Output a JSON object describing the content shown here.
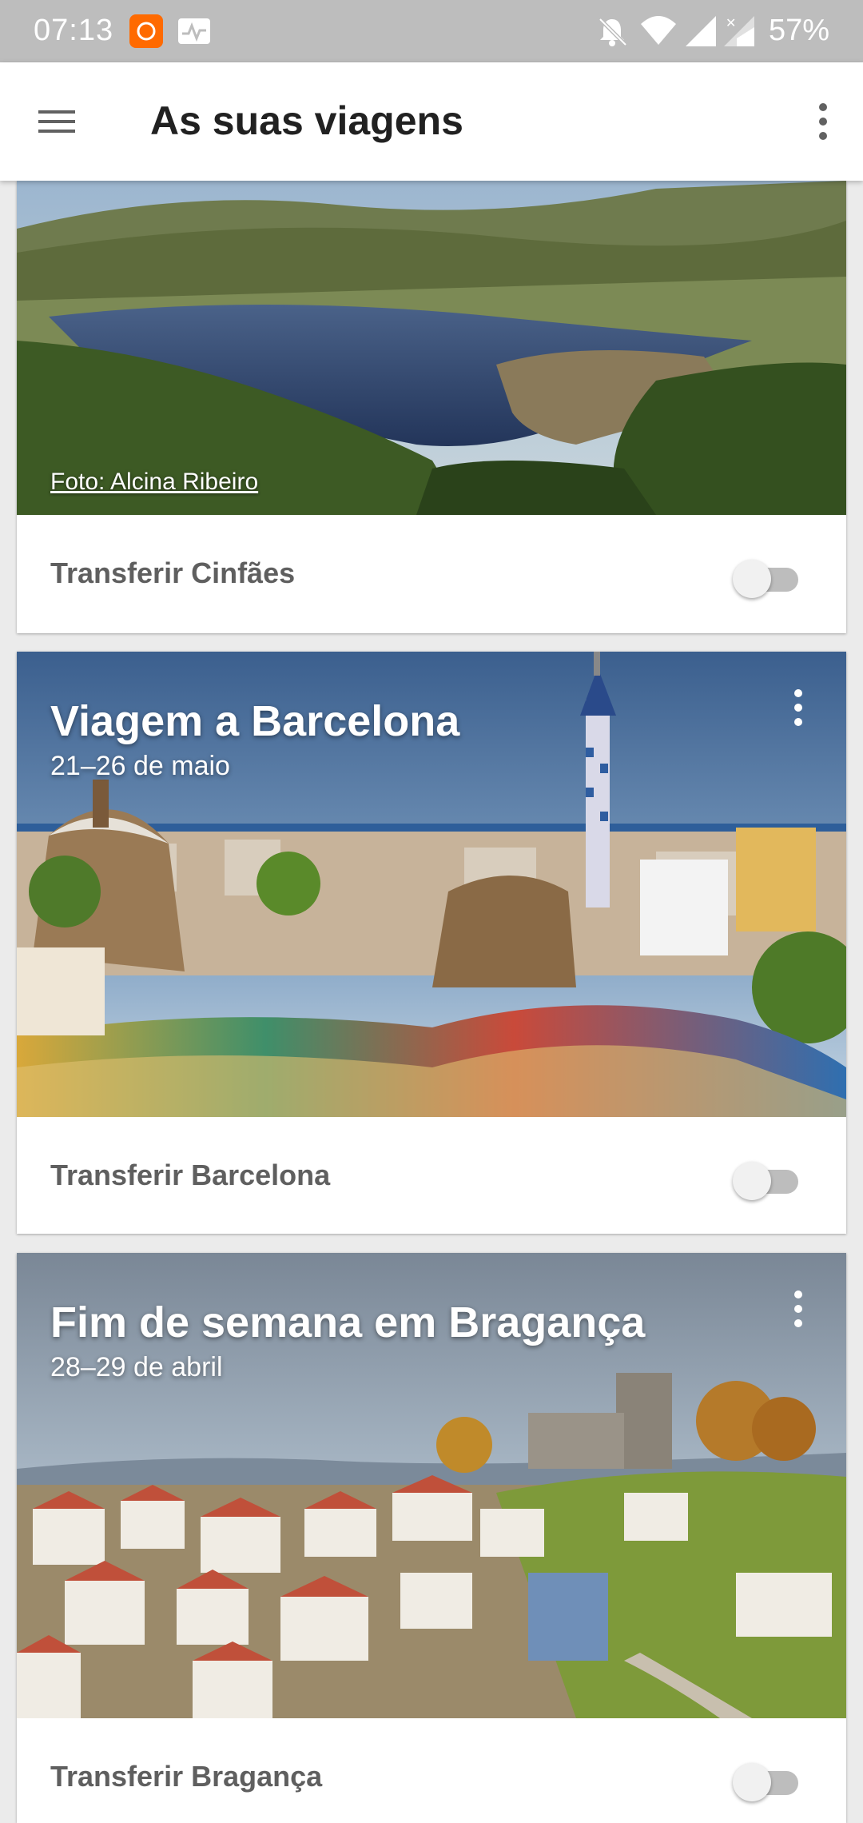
{
  "status_bar": {
    "time": "07:13",
    "battery": "57%",
    "icons": [
      "mi-app-icon",
      "activity-icon",
      "bell-off-icon",
      "wifi-icon",
      "signal-icon",
      "signal-x-icon"
    ]
  },
  "app_bar": {
    "title": "As suas viagens",
    "menu_icon": "hamburger-menu-icon",
    "overflow_icon": "more-vert-icon"
  },
  "trips": [
    {
      "photo_credit": "Foto: Alcina Ribeiro",
      "download_label": "Transferir Cinfães",
      "download_enabled": false
    },
    {
      "title": "Viagem a Barcelona",
      "dates": "21–26 de maio",
      "download_label": "Transferir Barcelona",
      "download_enabled": false
    },
    {
      "title": "Fim de semana em Bragança",
      "dates": "28–29 de abril",
      "download_label": "Transferir Bragança",
      "download_enabled": false
    }
  ],
  "colors": {
    "status_bar": "#bdbdbd",
    "app_bar": "#ffffff",
    "background": "#ebebeb",
    "toggle_off_track": "#bdbdbd"
  }
}
